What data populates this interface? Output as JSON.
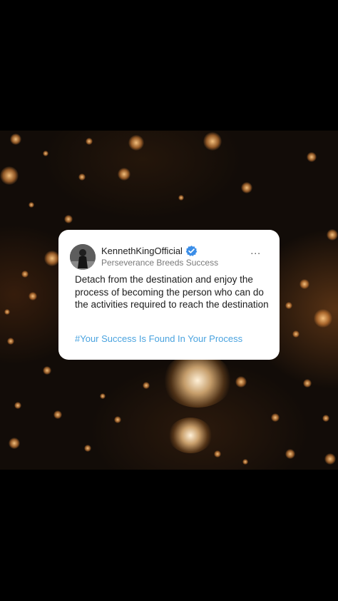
{
  "post": {
    "username": "KennethKingOfficial",
    "subtitle": "Perseverance Breeds Success",
    "text": "Detach from the destination and enjoy the process of becoming the person who can do the activities required to reach the destination",
    "hashtag": "#Your Success Is Found In Your Process",
    "more_label": "...",
    "verified_icon": "verified-badge-icon"
  },
  "colors": {
    "background": "#000000",
    "card": "#ffffff",
    "hashtag": "#4aa3df",
    "verified": "#3b8ee8",
    "bokeh": "#e8a05a"
  }
}
